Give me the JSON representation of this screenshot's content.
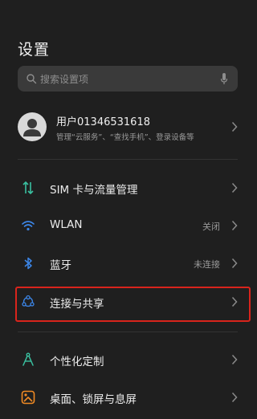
{
  "header": {
    "title": "设置"
  },
  "search": {
    "placeholder": "搜索设置项"
  },
  "account": {
    "name": "用户01346531618",
    "subtitle": "管理“云服务”、“查找手机”、登录设备等"
  },
  "items": [
    {
      "label": "SIM 卡与流量管理",
      "value": "",
      "icon": "sim-arrows-icon"
    },
    {
      "label": "WLAN",
      "value": "关闭",
      "icon": "wifi-icon"
    },
    {
      "label": "蓝牙",
      "value": "未连接",
      "icon": "bluetooth-icon"
    },
    {
      "label": "连接与共享",
      "value": "",
      "icon": "share-nodes-icon",
      "highlighted": true
    },
    {
      "label": "个性化定制",
      "value": "",
      "icon": "compass-icon"
    },
    {
      "label": "桌面、锁屏与息屏",
      "value": "",
      "icon": "wallpaper-icon"
    }
  ],
  "colors": {
    "background": "#1f1f1f",
    "search_bg": "#3a3a3a",
    "highlight_border": "#d9241c",
    "teal_icon": "#3ac0a0",
    "blue_icon": "#3c86e8",
    "orange_icon": "#f08a24"
  }
}
